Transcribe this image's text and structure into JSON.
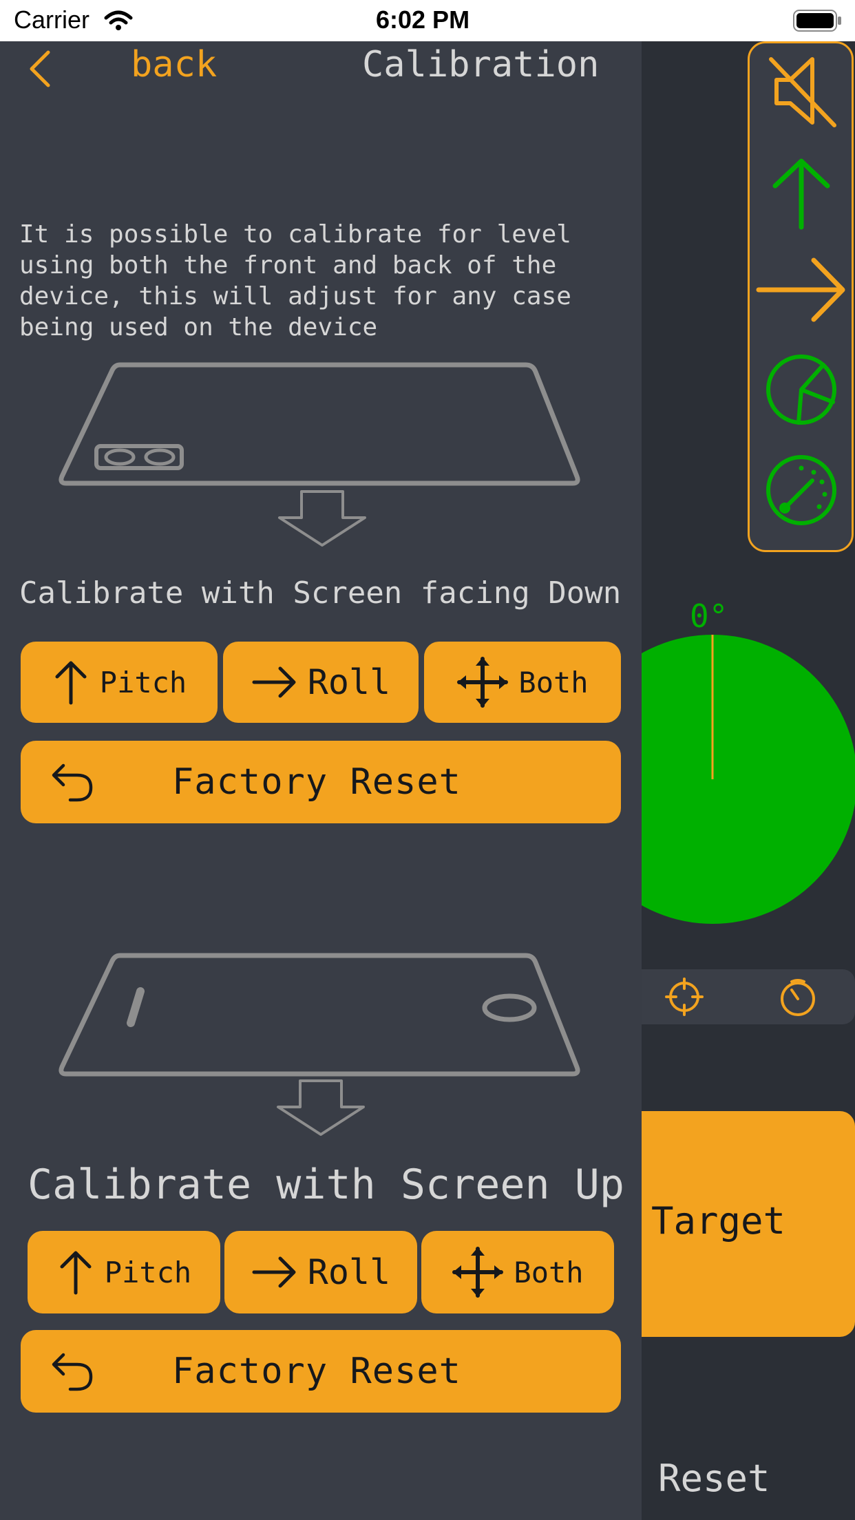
{
  "status_bar": {
    "carrier": "Carrier",
    "time": "6:02 PM"
  },
  "nav": {
    "back_label": "back",
    "title": "Calibration"
  },
  "description": "It is possible to calibrate for level\nusing both the front and back of the\ndevice, this will adjust for any case\nbeing used on the device",
  "section_down": {
    "heading": "Calibrate with Screen facing Down",
    "pitch_label": "Pitch",
    "roll_label": "Roll",
    "both_label": "Both",
    "reset_label": "Factory Reset"
  },
  "section_up": {
    "heading": "Calibrate with Screen Up",
    "pitch_label": "Pitch",
    "roll_label": "Roll",
    "both_label": "Both",
    "reset_label": "Factory Reset"
  },
  "gauge": {
    "angle_label": "0°"
  },
  "right_panel": {
    "target_label": "Target",
    "reset_label": "Reset"
  },
  "sidebar": {
    "icons": [
      "mute-icon",
      "arrow-up-icon",
      "arrow-right-icon",
      "pie-chart-icon",
      "speedometer-icon"
    ]
  },
  "colors": {
    "accent": "#f3a31f",
    "green": "#00b000",
    "panel": "#393d46",
    "text": "#d6d6d6"
  }
}
